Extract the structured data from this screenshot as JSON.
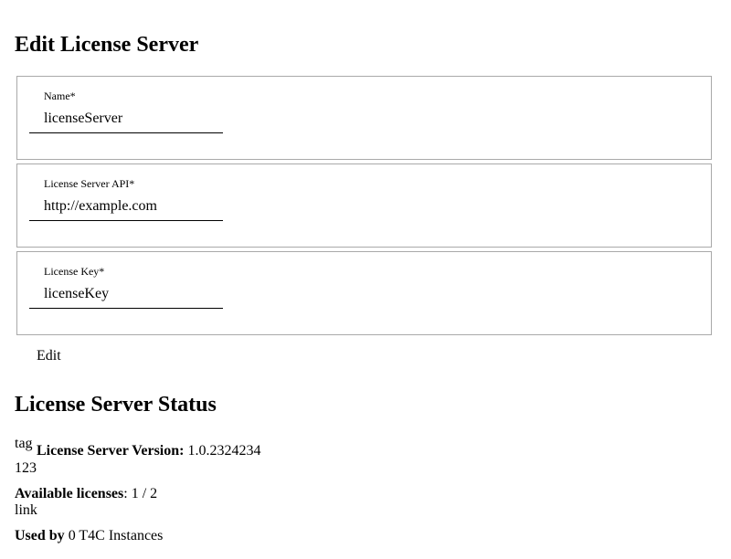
{
  "edit_section": {
    "title": "Edit License Server",
    "fields": [
      {
        "label": "Name*",
        "value": "licenseServer"
      },
      {
        "label": "License Server API*",
        "value": "http://example.com"
      },
      {
        "label": "License Key*",
        "value": "licenseKey"
      }
    ],
    "edit_button": "Edit"
  },
  "status_section": {
    "title": "License Server Status",
    "tag": "tag",
    "version_label": "License Server Version:",
    "version_value": "1.0.2324234",
    "line_123": "123",
    "available_label": "Available licenses",
    "available_value": ": 1 / 2",
    "link_text": "link",
    "used_label": "Used by",
    "used_value": "0 T4C Instances"
  }
}
